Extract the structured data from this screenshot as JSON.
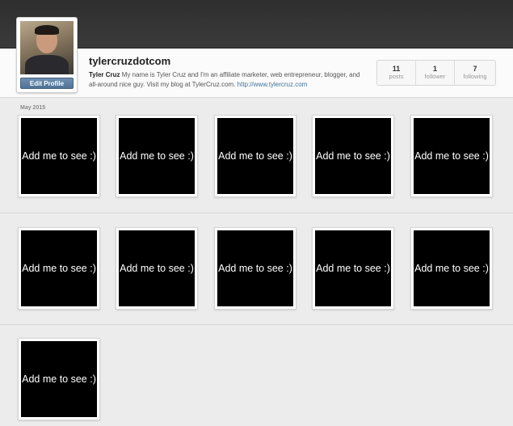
{
  "profile": {
    "username": "tylercruzdotcom",
    "edit_button": "Edit Profile",
    "bio_name": "Tyler Cruz",
    "bio_text": " My name is Tyler Cruz and I'm an affiliate marketer, web entrepreneur, blogger, and all-around nice guy. Visit my blog at TylerCruz.com. ",
    "bio_link": "http://www.tylercruz.com"
  },
  "stats": [
    {
      "value": "11",
      "label": "posts"
    },
    {
      "value": "1",
      "label": "follower"
    },
    {
      "value": "7",
      "label": "following"
    }
  ],
  "feed": {
    "date_label": "May 2015",
    "tile_text": "Add me to see :)",
    "post_count": 11
  },
  "colors": {
    "topbar": "#333333",
    "edit_button": "#5b80a4",
    "link": "#3f729b",
    "background": "#ececec"
  }
}
